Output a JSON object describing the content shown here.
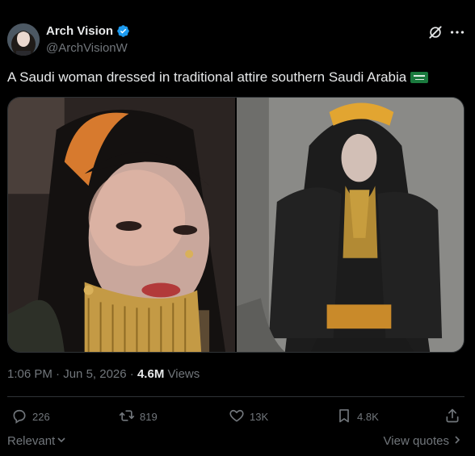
{
  "author": {
    "display_name": "Arch Vision",
    "handle": "@ArchVisionW",
    "verified": true
  },
  "header_icons": [
    "grok-icon",
    "more-icon"
  ],
  "tweet": {
    "text": "A Saudi woman dressed in traditional attire southern Saudi Arabia",
    "emoji": "saudi-flag"
  },
  "media": {
    "count": 2
  },
  "meta": {
    "time": "1:06 PM",
    "separator": "·",
    "date": "Jun 5, 2026",
    "separator2": "·",
    "views_count": "4.6M",
    "views_label": "Views"
  },
  "actions": {
    "replies": "226",
    "reposts": "819",
    "likes": "13K",
    "bookmarks": "4.8K"
  },
  "footer": {
    "sort_label": "Relevant",
    "view_quotes": "View quotes"
  },
  "colors": {
    "background": "#000000",
    "text": "#e7e9ea",
    "muted": "#71767b",
    "border": "#2f3336",
    "verified": "#1d9bf0"
  }
}
